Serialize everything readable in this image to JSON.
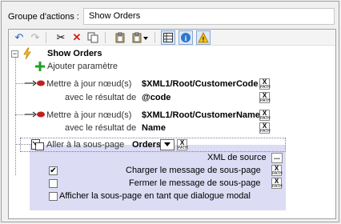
{
  "header": {
    "label": "Groupe d'actions :",
    "value": "Show Orders"
  },
  "toolbar": {
    "icons": [
      "undo-icon",
      "redo-icon",
      "cut-icon",
      "delete-icon",
      "copy-icon",
      "paste-icon",
      "paste-special-icon",
      "grid-icon",
      "info-icon",
      "warning-icon"
    ]
  },
  "tree": {
    "root_label": "Show Orders",
    "add_param": "Ajouter paramètre",
    "actions": [
      {
        "label": "Mettre à jour nœud(s)",
        "target": "$XML1/Root/CustomerCode",
        "result_label": "avec le résultat de",
        "result_value": "@code"
      },
      {
        "label": "Mettre à jour nœud(s)",
        "target": "$XML1/Root/CustomerName",
        "result_label": "avec le résultat de",
        "result_value": "Name"
      }
    ],
    "subpage": {
      "label": "Aller à la sous-page",
      "selected": "Orders",
      "xml_source": "XML de source",
      "load_message": "Charger le message de sous-page",
      "close_message": "Fermer le message de sous-page",
      "dialog_label": "Afficher la sous-page en tant que dialogue modal",
      "load_checked": true,
      "close_checked": false,
      "dialog_checked": false
    }
  },
  "xpath_label": {
    "x": "X",
    "p": "PATH"
  },
  "more_button": "..."
}
